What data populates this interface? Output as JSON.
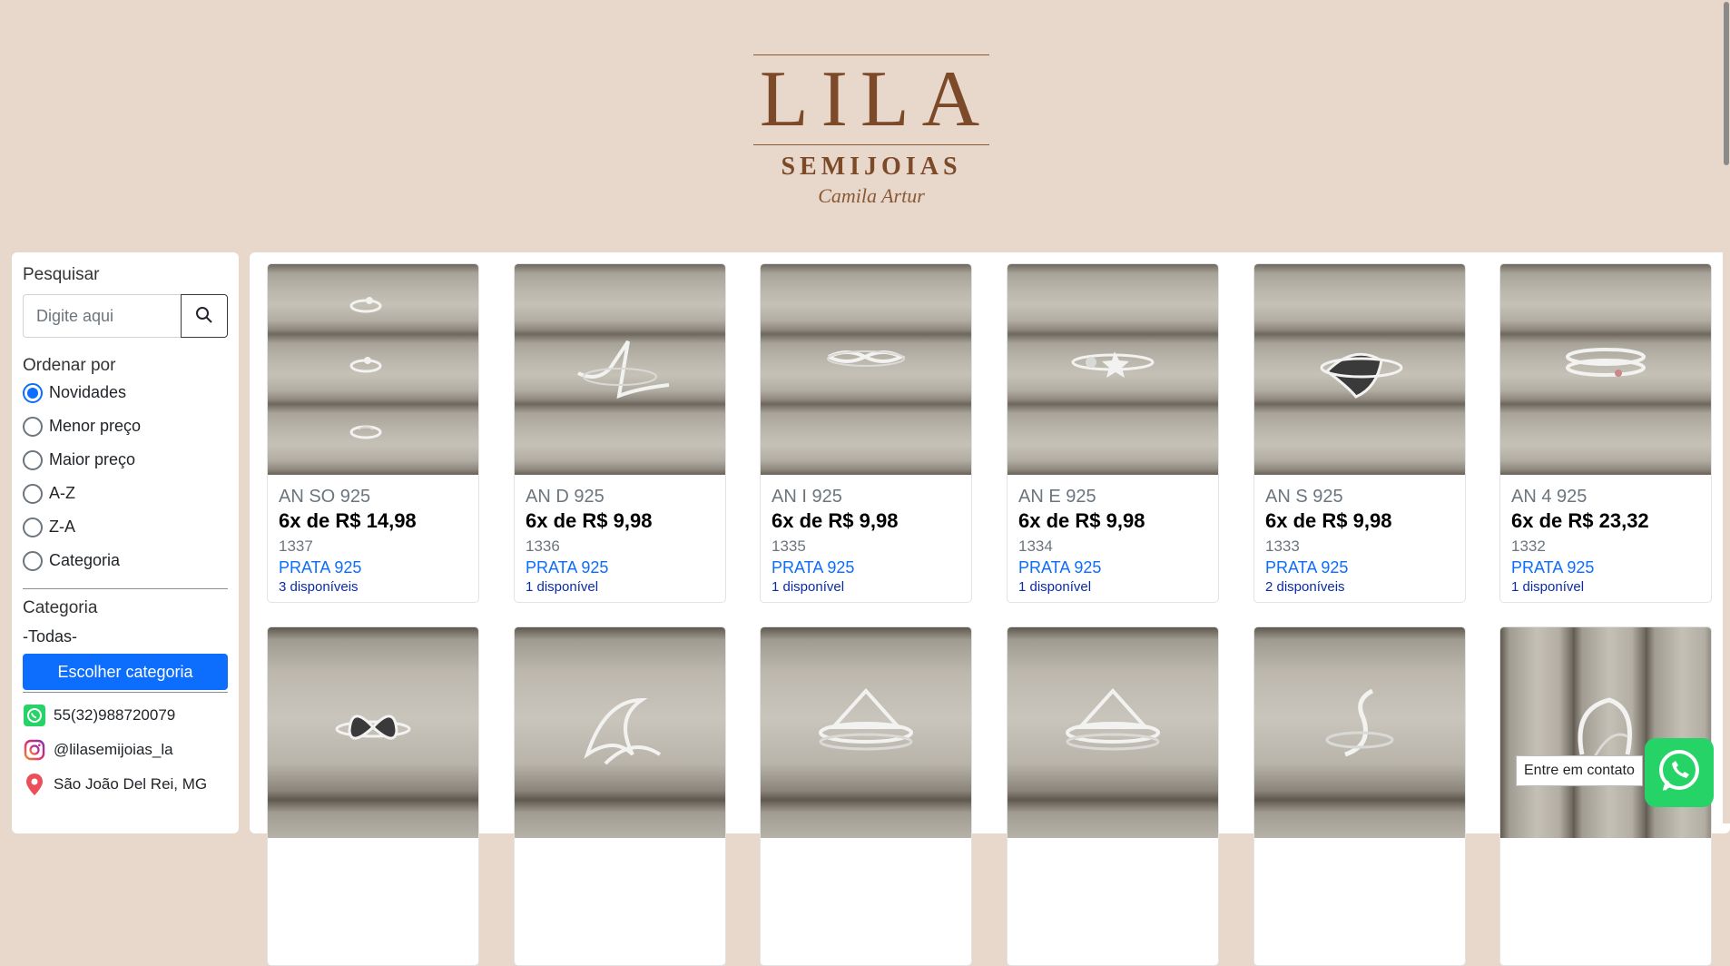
{
  "brand": {
    "name": "LILA",
    "subtitle": "SEMIJOIAS",
    "signature": "Camila Artur",
    "logo_color": "#7c4a28"
  },
  "sidebar": {
    "search_label": "Pesquisar",
    "search_placeholder": "Digite aqui",
    "search_icon": "search-icon",
    "sort_label": "Ordenar por",
    "sort_options": [
      {
        "label": "Novidades",
        "checked": true
      },
      {
        "label": "Menor preço",
        "checked": false
      },
      {
        "label": "Maior preço",
        "checked": false
      },
      {
        "label": "A-Z",
        "checked": false
      },
      {
        "label": "Z-A",
        "checked": false
      },
      {
        "label": "Categoria",
        "checked": false
      }
    ],
    "category_label": "Categoria",
    "category_value": "-Todas-",
    "category_button": "Escolher categoria",
    "contacts": [
      {
        "icon": "whatsapp-icon",
        "text": "55(32)988720079"
      },
      {
        "icon": "instagram-icon",
        "text": "@lilasemijoias_la"
      },
      {
        "icon": "location-pin-icon",
        "text": "São João Del Rei, MG"
      }
    ]
  },
  "products": [
    {
      "code": "AN SO 925",
      "price": "6x de R$ 14,98",
      "number": "1337",
      "material": "PRATA 925",
      "stock": "3 disponíveis",
      "image": "ring-triple"
    },
    {
      "code": "AN D 925",
      "price": "6x de R$ 9,98",
      "number": "1336",
      "material": "PRATA 925",
      "stock": "1 disponível",
      "image": "ring-zigzag"
    },
    {
      "code": "AN I 925",
      "price": "6x de R$ 9,98",
      "number": "1335",
      "material": "PRATA 925",
      "stock": "1 disponível",
      "image": "ring-infinity"
    },
    {
      "code": "AN E 925",
      "price": "6x de R$ 9,98",
      "number": "1334",
      "material": "PRATA 925",
      "stock": "1 disponível",
      "image": "ring-star"
    },
    {
      "code": "AN S 925",
      "price": "6x de R$ 9,98",
      "number": "1333",
      "material": "PRATA 925",
      "stock": "2 disponíveis",
      "image": "ring-leaf"
    },
    {
      "code": "AN 4 925",
      "price": "6x de R$ 23,32",
      "number": "1332",
      "material": "PRATA 925",
      "stock": "1 disponível",
      "image": "ring-stack"
    },
    {
      "code": "",
      "price": "",
      "number": "",
      "material": "",
      "stock": "",
      "image": "ring-butterfly"
    },
    {
      "code": "",
      "price": "",
      "number": "",
      "material": "",
      "stock": "",
      "image": "ring-wave"
    },
    {
      "code": "",
      "price": "",
      "number": "",
      "material": "",
      "stock": "",
      "image": "ring-triangle"
    },
    {
      "code": "",
      "price": "",
      "number": "",
      "material": "",
      "stock": "",
      "image": "ring-triangle"
    },
    {
      "code": "",
      "price": "",
      "number": "",
      "material": "",
      "stock": "",
      "image": "ring-snake"
    },
    {
      "code": "",
      "price": "",
      "number": "",
      "material": "",
      "stock": "",
      "image": "ring-open"
    }
  ],
  "floating": {
    "label": "Entre em contato",
    "icon": "whatsapp-icon",
    "color": "#25d366"
  },
  "colors": {
    "background": "#e7d8cb",
    "accent": "#0d6efd"
  }
}
